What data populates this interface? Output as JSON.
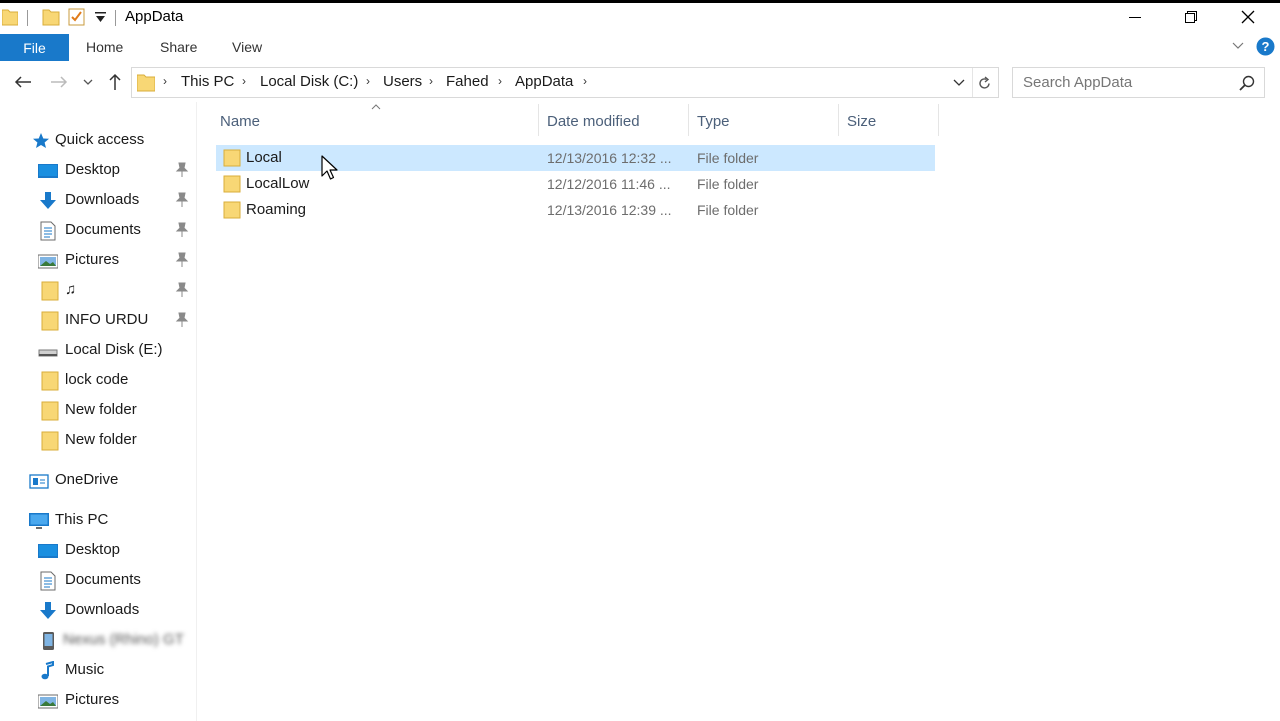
{
  "window": {
    "title": "AppData",
    "minimize_glyph": "—",
    "restore_glyph": "❐",
    "close_glyph": "✕"
  },
  "ribbon": {
    "file_label": "File",
    "tabs": [
      {
        "label": "Home"
      },
      {
        "label": "Share"
      },
      {
        "label": "View"
      }
    ]
  },
  "address": {
    "crumbs": [
      {
        "label": "This PC"
      },
      {
        "label": "Local Disk (C:)"
      },
      {
        "label": "Users"
      },
      {
        "label": "Fahed"
      },
      {
        "label": "AppData"
      }
    ],
    "search_placeholder": "Search AppData"
  },
  "sidebar": {
    "quick_access_label": "Quick access",
    "quick_access_items": [
      {
        "label": "Desktop",
        "icon": "desktop-icon",
        "pinned": true
      },
      {
        "label": "Downloads",
        "icon": "downloads-icon",
        "pinned": true
      },
      {
        "label": "Documents",
        "icon": "documents-icon",
        "pinned": true
      },
      {
        "label": "Pictures",
        "icon": "pictures-icon",
        "pinned": true
      },
      {
        "label": "♫",
        "icon": "folder-icon",
        "pinned": true
      },
      {
        "label": "INFO URDU",
        "icon": "folder-icon",
        "pinned": true
      },
      {
        "label": "Local Disk (E:)",
        "icon": "drive-icon",
        "pinned": false
      },
      {
        "label": "lock code",
        "icon": "folder-icon",
        "pinned": false
      },
      {
        "label": "New folder",
        "icon": "folder-icon",
        "pinned": false
      },
      {
        "label": "New folder",
        "icon": "folder-icon",
        "pinned": false
      }
    ],
    "onedrive_label": "OneDrive",
    "thispc_label": "This PC",
    "thispc_items": [
      {
        "label": "Desktop",
        "icon": "desktop-icon"
      },
      {
        "label": "Documents",
        "icon": "documents-icon"
      },
      {
        "label": "Downloads",
        "icon": "downloads-icon"
      },
      {
        "label": "Nexus (Rhino) GT",
        "icon": "phone-icon",
        "blurred": true
      },
      {
        "label": "Music",
        "icon": "music-icon"
      },
      {
        "label": "Pictures",
        "icon": "pictures-icon"
      }
    ]
  },
  "file_list": {
    "columns": [
      {
        "label": "Name"
      },
      {
        "label": "Date modified"
      },
      {
        "label": "Type"
      },
      {
        "label": "Size"
      }
    ],
    "rows": [
      {
        "name": "Local",
        "date": "12/13/2016 12:32 ...",
        "type": "File folder",
        "selected": true
      },
      {
        "name": "LocalLow",
        "date": "12/12/2016 11:46 ...",
        "type": "File folder",
        "selected": false
      },
      {
        "name": "Roaming",
        "date": "12/13/2016 12:39 ...",
        "type": "File folder",
        "selected": false
      }
    ]
  },
  "colors": {
    "accent": "#1979ca",
    "selection": "#cce8ff",
    "folder": "#f8d775"
  }
}
